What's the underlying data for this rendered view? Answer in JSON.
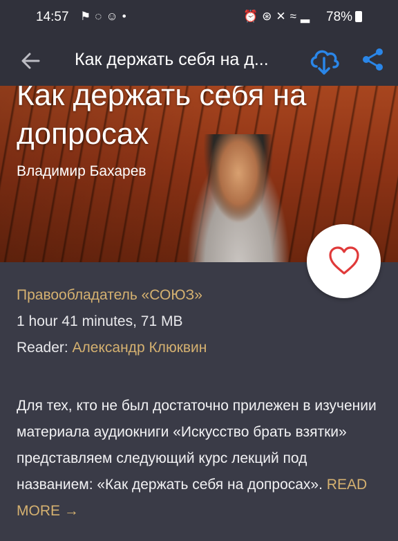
{
  "status_bar": {
    "time": "14:57",
    "battery": "78%",
    "left_icons": [
      "notification-icon",
      "app-icon",
      "face-icon",
      "dot-icon"
    ],
    "right_icons": [
      "alarm-icon",
      "bluetooth-icon",
      "mute-icon",
      "wifi-icon",
      "signal-icon",
      "battery-icon"
    ]
  },
  "appbar": {
    "title": "Как держать себя на д..."
  },
  "hero": {
    "title": "Как держать себя на допросах",
    "author": "Владимир Бахарев"
  },
  "meta": {
    "rightholder": "Правообладатель «СОЮЗ»",
    "duration_size": "1 hour 41 minutes, 71 MB",
    "reader_label": "Reader: ",
    "reader_name": "Александр Клюквин"
  },
  "description": {
    "text": "Для тех,  кто не был достаточно прилежен в изучении материала аудиокниги «Искусство брать взятки» представляем следующий курс лекций под названием: «Как держать себя на допросах». ",
    "read_more": "READ MORE →"
  },
  "colors": {
    "accent_gold": "#d5b170",
    "download_blue": "#2a86e8",
    "heart_red": "#e03a3a",
    "background": "#3a3b47"
  }
}
